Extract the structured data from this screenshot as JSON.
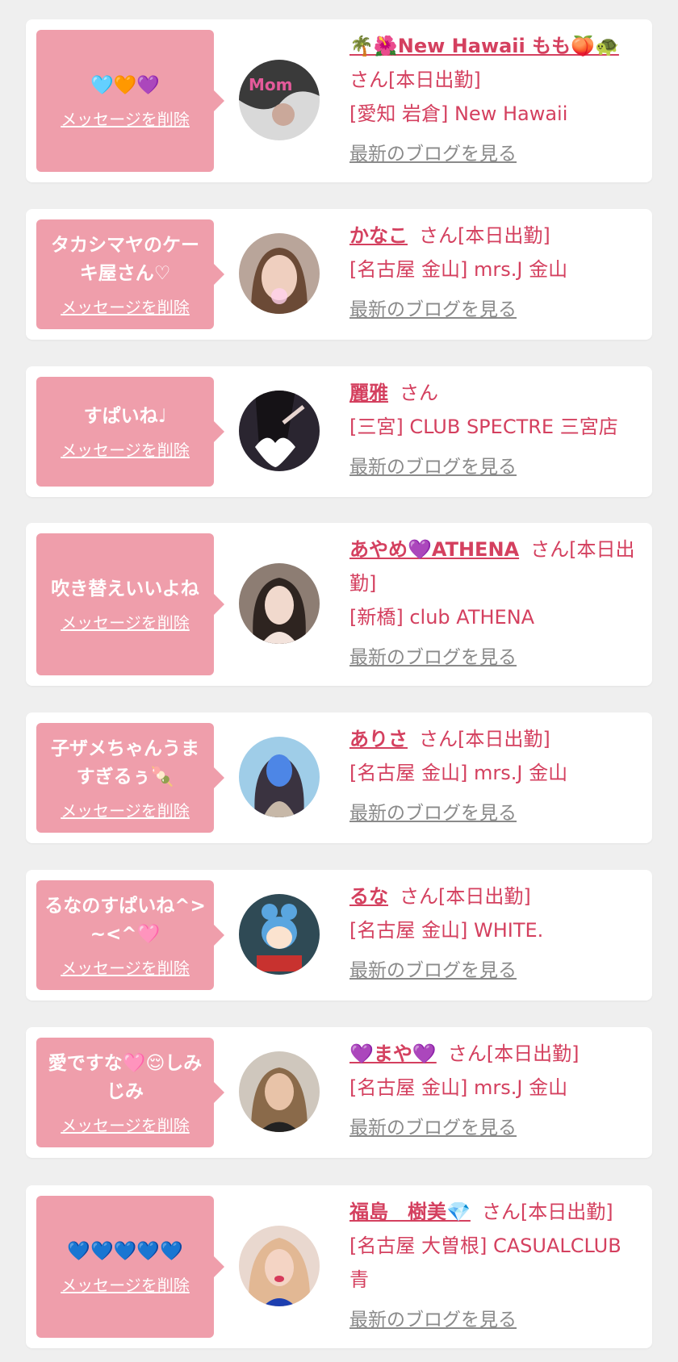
{
  "delete_label": "メッセージを削除",
  "blog_label": "最新のブログを見る",
  "colors": {
    "page_bg": "#efefef",
    "card_bg": "#ffffff",
    "bubble_bg": "#ef9eab",
    "accent_text": "#d4405f",
    "link_gray": "#8a8a8a"
  },
  "messages": [
    {
      "message": "🩵🧡💜",
      "name": "🌴🌺New Hawaii もも🍑🐢",
      "suffix": "さん[本日出勤]",
      "shop": "[愛知 岩倉] New Hawaii"
    },
    {
      "message": "タカシマヤのケーキ屋さん♡",
      "name": "かなこ",
      "suffix": "さん[本日出勤]",
      "shop": "[名古屋 金山] mrs.J 金山"
    },
    {
      "message": "すぱいね♩",
      "name": "麗雅",
      "suffix": "さん",
      "shop": "[三宮] CLUB SPECTRE 三宮店"
    },
    {
      "message": "吹き替えいいよね",
      "name": "あやめ💜ATHENA",
      "suffix": "さん[本日出勤]",
      "shop": "[新橋] club ATHENA"
    },
    {
      "message": "子ザメちゃんうますぎるぅ🍡",
      "name": "ありさ",
      "suffix": "さん[本日出勤]",
      "shop": "[名古屋 金山] mrs.J 金山"
    },
    {
      "message": "るなのすぱいね^>~<^🩷",
      "name": "るな",
      "suffix": "さん[本日出勤]",
      "shop": "[名古屋 金山] WHITE."
    },
    {
      "message": "愛ですな🩷😌しみじみ",
      "name": "💜まや💜",
      "suffix": "さん[本日出勤]",
      "shop": "[名古屋 金山] mrs.J 金山"
    },
    {
      "message": "💙💙💙💙💙",
      "name": "福島　樹美💎",
      "suffix": "さん[本日出勤]",
      "shop": "[名古屋 大曽根] CASUALCLUB 青"
    }
  ]
}
